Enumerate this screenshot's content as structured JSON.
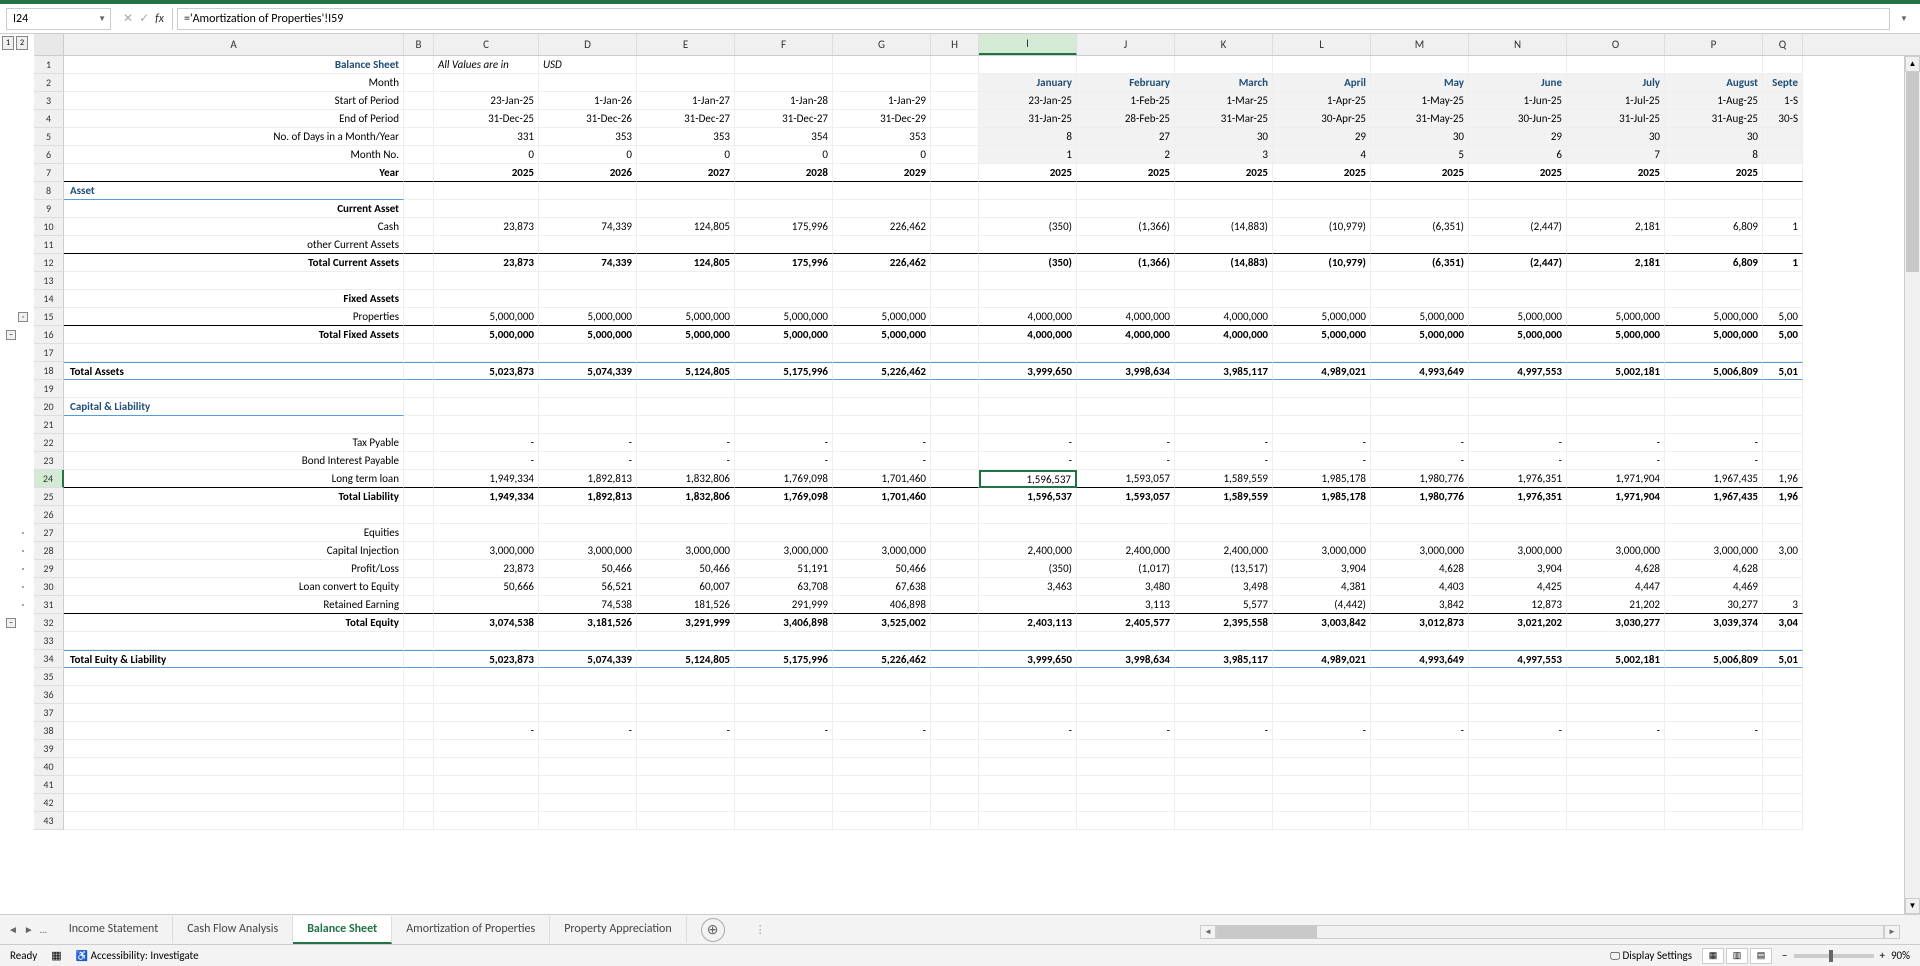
{
  "nameBox": "I24",
  "formula": "='Amortization of Properties'!I59",
  "columns": [
    "A",
    "B",
    "C",
    "D",
    "E",
    "F",
    "G",
    "H",
    "I",
    "J",
    "K",
    "L",
    "M",
    "N",
    "O",
    "P",
    "Q"
  ],
  "selectedCol": "I",
  "selectedRow": 24,
  "outlineLevels": [
    "1",
    "2"
  ],
  "rowLabels": {
    "1": "Balance Sheet",
    "1_note": "All Values are in",
    "1_cur": "USD",
    "2": "Month",
    "3": "Start of Period",
    "4": "End of Period",
    "5": "No. of Days in a Month/Year",
    "6": "Month No.",
    "7": "Year",
    "8": "Asset",
    "9": "Current Asset",
    "10": "Cash",
    "11": "other Current Assets",
    "12": "Total Current Assets",
    "14": "Fixed Assets",
    "15": "Properties",
    "16": "Total Fixed Assets",
    "18": "Total Assets",
    "20": "Capital & Liability",
    "22": "Tax Pyable",
    "23": "Bond Interest Payable",
    "24": "Long term loan",
    "25": "Total Liability",
    "27": "Equities",
    "28": "Capital Injection",
    "29": "Profit/Loss",
    "30": "Loan convert to Equity",
    "31": "Retained Earning",
    "32": "Total Equity",
    "34": "Total Euity & Liability"
  },
  "months": [
    "January",
    "February",
    "March",
    "April",
    "May",
    "June",
    "July",
    "August",
    "Septe"
  ],
  "data": {
    "r2": [
      "",
      "",
      "",
      "",
      "",
      "",
      "January",
      "February",
      "March",
      "April",
      "May",
      "June",
      "July",
      "August",
      "Septe"
    ],
    "r3": [
      "23-Jan-25",
      "1-Jan-26",
      "1-Jan-27",
      "1-Jan-28",
      "1-Jan-29",
      "",
      "23-Jan-25",
      "1-Feb-25",
      "1-Mar-25",
      "1-Apr-25",
      "1-May-25",
      "1-Jun-25",
      "1-Jul-25",
      "1-Aug-25",
      "1-S"
    ],
    "r4": [
      "31-Dec-25",
      "31-Dec-26",
      "31-Dec-27",
      "31-Dec-27",
      "31-Dec-29",
      "",
      "31-Jan-25",
      "28-Feb-25",
      "31-Mar-25",
      "30-Apr-25",
      "31-May-25",
      "30-Jun-25",
      "31-Jul-25",
      "31-Aug-25",
      "30-S"
    ],
    "r5": [
      "331",
      "353",
      "353",
      "354",
      "353",
      "",
      "8",
      "27",
      "30",
      "29",
      "30",
      "29",
      "30",
      "30",
      ""
    ],
    "r6": [
      "0",
      "0",
      "0",
      "0",
      "0",
      "",
      "1",
      "2",
      "3",
      "4",
      "5",
      "6",
      "7",
      "8",
      ""
    ],
    "r7": [
      "2025",
      "2026",
      "2027",
      "2028",
      "2029",
      "",
      "2025",
      "2025",
      "2025",
      "2025",
      "2025",
      "2025",
      "2025",
      "2025",
      ""
    ],
    "r10": [
      "23,873",
      "74,339",
      "124,805",
      "175,996",
      "226,462",
      "",
      "(350)",
      "(1,366)",
      "(14,883)",
      "(10,979)",
      "(6,351)",
      "(2,447)",
      "2,181",
      "6,809",
      "1"
    ],
    "r12": [
      "23,873",
      "74,339",
      "124,805",
      "175,996",
      "226,462",
      "",
      "(350)",
      "(1,366)",
      "(14,883)",
      "(10,979)",
      "(6,351)",
      "(2,447)",
      "2,181",
      "6,809",
      "1"
    ],
    "r15": [
      "5,000,000",
      "5,000,000",
      "5,000,000",
      "5,000,000",
      "5,000,000",
      "",
      "4,000,000",
      "4,000,000",
      "4,000,000",
      "5,000,000",
      "5,000,000",
      "5,000,000",
      "5,000,000",
      "5,000,000",
      "5,00"
    ],
    "r16": [
      "5,000,000",
      "5,000,000",
      "5,000,000",
      "5,000,000",
      "5,000,000",
      "",
      "4,000,000",
      "4,000,000",
      "4,000,000",
      "5,000,000",
      "5,000,000",
      "5,000,000",
      "5,000,000",
      "5,000,000",
      "5,00"
    ],
    "r18": [
      "5,023,873",
      "5,074,339",
      "5,124,805",
      "5,175,996",
      "5,226,462",
      "",
      "3,999,650",
      "3,998,634",
      "3,985,117",
      "4,989,021",
      "4,993,649",
      "4,997,553",
      "5,002,181",
      "5,006,809",
      "5,01"
    ],
    "r22": [
      "-",
      "-",
      "-",
      "-",
      "-",
      "",
      "-",
      "-",
      "-",
      "-",
      "-",
      "-",
      "-",
      "-",
      ""
    ],
    "r23": [
      "-",
      "-",
      "-",
      "-",
      "-",
      "",
      "-",
      "-",
      "-",
      "-",
      "-",
      "-",
      "-",
      "-",
      ""
    ],
    "r24": [
      "1,949,334",
      "1,892,813",
      "1,832,806",
      "1,769,098",
      "1,701,460",
      "",
      "1,596,537",
      "1,593,057",
      "1,589,559",
      "1,985,178",
      "1,980,776",
      "1,976,351",
      "1,971,904",
      "1,967,435",
      "1,96"
    ],
    "r25": [
      "1,949,334",
      "1,892,813",
      "1,832,806",
      "1,769,098",
      "1,701,460",
      "",
      "1,596,537",
      "1,593,057",
      "1,589,559",
      "1,985,178",
      "1,980,776",
      "1,976,351",
      "1,971,904",
      "1,967,435",
      "1,96"
    ],
    "r28": [
      "3,000,000",
      "3,000,000",
      "3,000,000",
      "3,000,000",
      "3,000,000",
      "",
      "2,400,000",
      "2,400,000",
      "2,400,000",
      "3,000,000",
      "3,000,000",
      "3,000,000",
      "3,000,000",
      "3,000,000",
      "3,00"
    ],
    "r29": [
      "23,873",
      "50,466",
      "50,466",
      "51,191",
      "50,466",
      "",
      "(350)",
      "(1,017)",
      "(13,517)",
      "3,904",
      "4,628",
      "3,904",
      "4,628",
      "4,628",
      ""
    ],
    "r30": [
      "50,666",
      "56,521",
      "60,007",
      "63,708",
      "67,638",
      "",
      "3,463",
      "3,480",
      "3,498",
      "4,381",
      "4,403",
      "4,425",
      "4,447",
      "4,469",
      ""
    ],
    "r31": [
      "",
      "74,538",
      "181,526",
      "291,999",
      "406,898",
      "",
      "",
      "3,113",
      "5,577",
      "(4,442)",
      "3,842",
      "12,873",
      "21,202",
      "30,277",
      "3"
    ],
    "r32": [
      "3,074,538",
      "3,181,526",
      "3,291,999",
      "3,406,898",
      "3,525,002",
      "",
      "2,403,113",
      "2,405,577",
      "2,395,558",
      "3,003,842",
      "3,012,873",
      "3,021,202",
      "3,030,277",
      "3,039,374",
      "3,04"
    ],
    "r34": [
      "5,023,873",
      "5,074,339",
      "5,124,805",
      "5,175,996",
      "5,226,462",
      "",
      "3,999,650",
      "3,998,634",
      "3,985,117",
      "4,989,021",
      "4,993,649",
      "4,997,553",
      "5,002,181",
      "5,006,809",
      "5,01"
    ],
    "r38": [
      "-",
      "-",
      "-",
      "-",
      "-",
      "",
      "-",
      "-",
      "-",
      "-",
      "-",
      "-",
      "-",
      "-",
      ""
    ]
  },
  "sheetTabs": [
    "Income Statement",
    "Cash Flow Analysis",
    "Balance Sheet",
    "Amortization of Properties",
    "Property Appreciation"
  ],
  "activeTab": "Balance Sheet",
  "status": {
    "ready": "Ready",
    "access": "Accessibility: Investigate",
    "display": "Display Settings",
    "zoom": "90%"
  }
}
